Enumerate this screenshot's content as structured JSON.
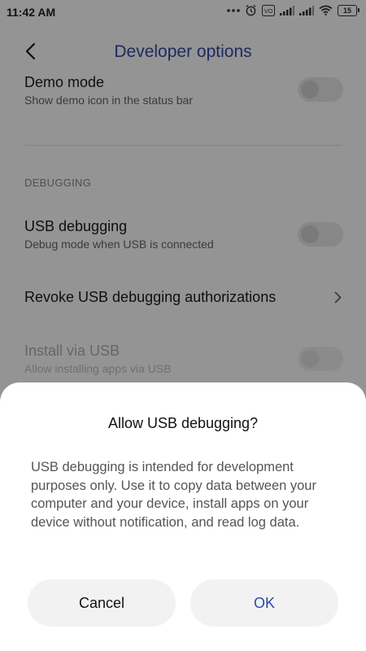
{
  "status_bar": {
    "time": "11:42 AM",
    "battery": "15"
  },
  "header": {
    "title": "Developer options"
  },
  "settings": {
    "demo_mode": {
      "title": "Demo mode",
      "subtitle": "Show demo icon in the status bar"
    },
    "section_debugging": "DEBUGGING",
    "usb_debugging": {
      "title": "USB debugging",
      "subtitle": "Debug mode when USB is connected"
    },
    "revoke": {
      "title": "Revoke USB debugging authorizations"
    },
    "install_via_usb": {
      "title": "Install via USB",
      "subtitle": "Allow installing apps via USB"
    }
  },
  "dialog": {
    "title": "Allow USB debugging?",
    "message": "USB debugging is intended for development purposes only. Use it to copy data between your computer and your device, install apps on your device without notification, and read log data.",
    "cancel_label": "Cancel",
    "ok_label": "OK"
  },
  "colors": {
    "accent": "#3449a8",
    "ok_text": "#2d4aa8",
    "dim_overlay": "rgba(0,0,0,0.42)"
  },
  "icons": {
    "back": "chevron-left-icon",
    "chevron": "chevron-right-icon"
  }
}
